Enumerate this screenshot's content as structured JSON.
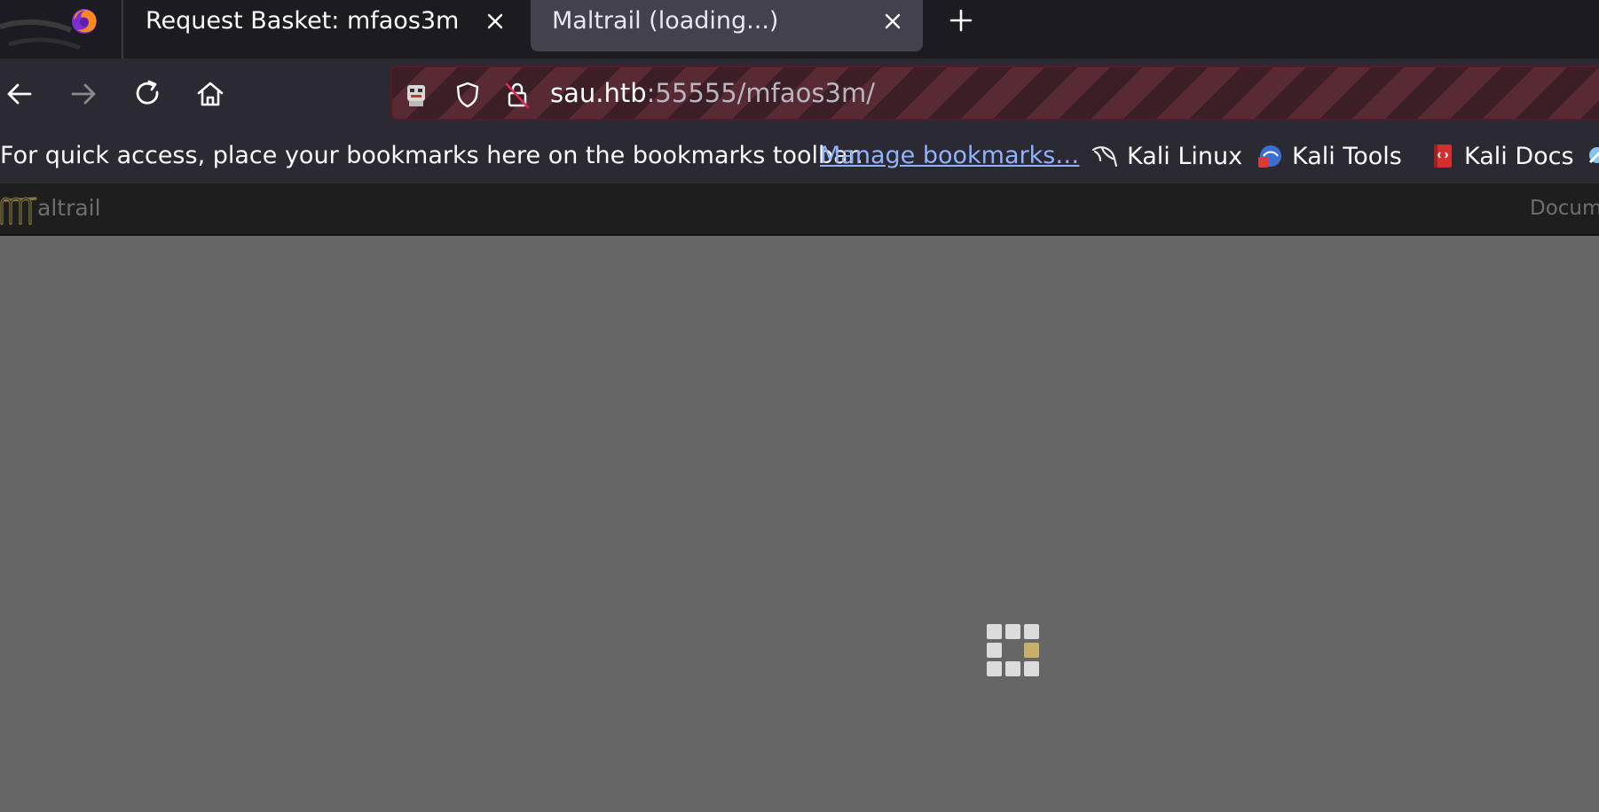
{
  "browser": {
    "tabs": [
      {
        "title": "Request Basket: mfaos3m",
        "active": false
      },
      {
        "title": "Maltrail (loading...)",
        "active": true
      }
    ],
    "url": {
      "host": "sau.htb",
      "rest": ":55555/mfaos3m/"
    },
    "bookmarks": {
      "hint": "For quick access, place your bookmarks here on the bookmarks toolbar.",
      "manage_link": "Manage bookmarks…",
      "items": [
        {
          "label": "Kali Linux",
          "icon": "kali-dragon-icon"
        },
        {
          "label": "Kali Tools",
          "icon": "kali-tools-icon"
        },
        {
          "label": "Kali Docs",
          "icon": "kali-docs-icon"
        }
      ]
    }
  },
  "page": {
    "logo_text": "altrail",
    "nav_docs": "Docume",
    "loading": true
  },
  "colors": {
    "page_background": "#666666",
    "spinner_active": "#c8b06a"
  }
}
